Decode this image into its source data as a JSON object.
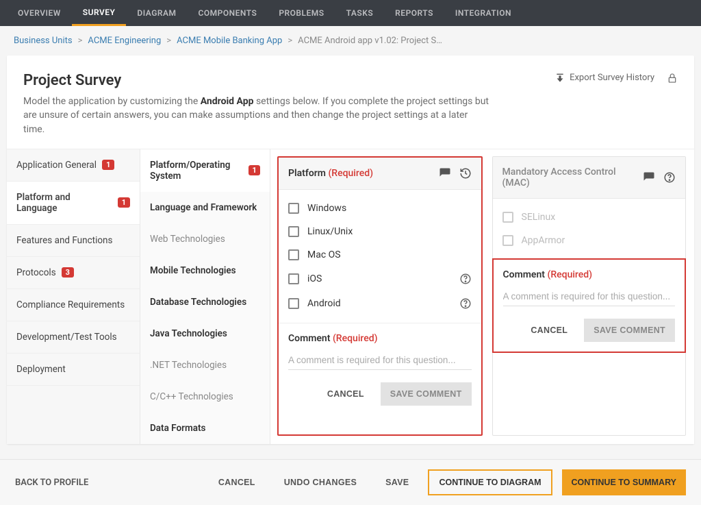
{
  "nav": {
    "tabs": [
      "OVERVIEW",
      "SURVEY",
      "DIAGRAM",
      "COMPONENTS",
      "PROBLEMS",
      "TASKS",
      "REPORTS",
      "INTEGRATION"
    ],
    "active_index": 1
  },
  "breadcrumbs": {
    "items": [
      "Business Units",
      "ACME Engineering",
      "ACME Mobile Banking App"
    ],
    "current": "ACME Android app v1.02: Project S…"
  },
  "header": {
    "title": "Project Survey",
    "description_pre": "Model the application by customizing the ",
    "description_bold": "Android App",
    "description_post": " settings below. If you complete the project settings but are unsure of certain answers, you can make assumptions and then change the project settings at a later time.",
    "export_label": "Export Survey History"
  },
  "left_nav": [
    {
      "label": "Application General",
      "badge": "1",
      "active": false
    },
    {
      "label": "Platform and Language",
      "badge": "1",
      "active": true
    },
    {
      "label": "Features and Functions",
      "badge": null,
      "active": false
    },
    {
      "label": "Protocols",
      "badge": "3",
      "active": false
    },
    {
      "label": "Compliance Requirements",
      "badge": null,
      "active": false
    },
    {
      "label": "Development/Test Tools",
      "badge": null,
      "active": false
    },
    {
      "label": "Deployment",
      "badge": null,
      "active": false
    }
  ],
  "mid_nav": [
    {
      "label": "Platform/Operating System",
      "badge": "1",
      "bold": true,
      "selected": true
    },
    {
      "label": "Language and Framework",
      "bold": true
    },
    {
      "label": "Web Technologies",
      "bold": false
    },
    {
      "label": "Mobile Technologies",
      "bold": true
    },
    {
      "label": "Database Technologies",
      "bold": true
    },
    {
      "label": "Java Technologies",
      "bold": true
    },
    {
      "label": ".NET Technologies",
      "bold": false
    },
    {
      "label": "C/C++ Technologies",
      "bold": false
    },
    {
      "label": "Data Formats",
      "bold": true
    }
  ],
  "panel_platform": {
    "title": "Platform",
    "required": "(Required)",
    "options": [
      {
        "label": "Windows",
        "help": false
      },
      {
        "label": "Linux/Unix",
        "help": false
      },
      {
        "label": "Mac OS",
        "help": false
      },
      {
        "label": "iOS",
        "help": true
      },
      {
        "label": "Android",
        "help": true
      }
    ],
    "comment_label": "Comment",
    "comment_required": "(Required)",
    "comment_placeholder": "A comment is required for this question...",
    "cancel": "CANCEL",
    "save": "SAVE COMMENT"
  },
  "panel_mac": {
    "title": "Mandatory Access Control (MAC)",
    "options": [
      {
        "label": "SELinux"
      },
      {
        "label": "AppArmor"
      }
    ],
    "comment_label": "Comment",
    "comment_required": "(Required)",
    "comment_placeholder": "A comment is required for this question...",
    "cancel": "CANCEL",
    "save": "SAVE COMMENT"
  },
  "footer": {
    "back": "BACK TO PROFILE",
    "cancel": "CANCEL",
    "undo": "UNDO CHANGES",
    "save": "SAVE",
    "continue_diagram": "CONTINUE TO DIAGRAM",
    "continue_summary": "CONTINUE TO SUMMARY"
  }
}
